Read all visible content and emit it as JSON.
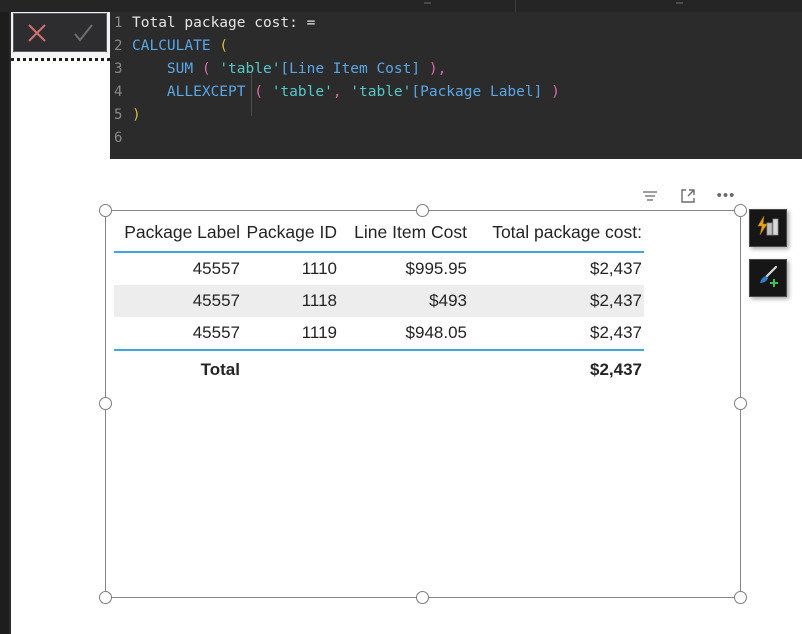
{
  "app": {
    "title": "Power BI Desktop - DAX measure editor with table visual"
  },
  "formula_bar": {
    "cancel_label": "Cancel",
    "accept_label": "Accept",
    "cancel_icon": "close-x-icon",
    "accept_icon": "checkmark-icon",
    "cancel_color": "#d07070",
    "accept_color": "#707070"
  },
  "dax_editor": {
    "background": "#2b2b2b",
    "measure_name": "Total package cost:",
    "line_numbers": [
      "1",
      "2",
      "3",
      "4",
      "5",
      "6"
    ],
    "lines": [
      {
        "number": "1",
        "text": "Total package cost: =",
        "tokens": [
          {
            "t": "Total package cost: =",
            "c": "tok-plain"
          }
        ]
      },
      {
        "number": "2",
        "text": "CALCULATE (",
        "tokens": [
          {
            "t": "CALCULATE ",
            "c": "tok-fn"
          },
          {
            "t": "(",
            "c": "tok-paren1"
          }
        ]
      },
      {
        "number": "3",
        "text": "    SUM ( 'table'[Line Item Cost] ),",
        "tokens": [
          {
            "t": "    ",
            "c": "tok-plain"
          },
          {
            "t": "SUM ",
            "c": "tok-fn"
          },
          {
            "t": "( ",
            "c": "tok-paren2"
          },
          {
            "t": "'table'",
            "c": "tok-str"
          },
          {
            "t": "[Line Item Cost]",
            "c": "tok-brkt"
          },
          {
            "t": " )",
            "c": "tok-paren2"
          },
          {
            "t": ",",
            "c": "tok-comma"
          }
        ]
      },
      {
        "number": "4",
        "text": "    ALLEXCEPT ( 'table', 'table'[Package Label] )",
        "tokens": [
          {
            "t": "    ",
            "c": "tok-plain"
          },
          {
            "t": "ALLEXCEPT ",
            "c": "tok-fn"
          },
          {
            "t": "( ",
            "c": "tok-paren2"
          },
          {
            "t": "'table'",
            "c": "tok-str"
          },
          {
            "t": ",",
            "c": "tok-comma"
          },
          {
            "t": " 'table'",
            "c": "tok-str"
          },
          {
            "t": "[Package Label]",
            "c": "tok-brkt"
          },
          {
            "t": " )",
            "c": "tok-paren2"
          }
        ]
      },
      {
        "number": "5",
        "text": ")",
        "tokens": [
          {
            "t": ")",
            "c": "tok-paren1"
          }
        ]
      },
      {
        "number": "6",
        "text": "",
        "tokens": []
      }
    ]
  },
  "visual_header": {
    "filter_icon": "filter-icon",
    "filter_label": "Filters",
    "focus_icon": "focus-mode-icon",
    "focus_label": "Focus mode",
    "more_icon": "more-options-icon",
    "more_label": "More options",
    "more_glyph": "•••"
  },
  "floating_buttons": [
    {
      "name": "analyze-button",
      "icon": "lightning-bar-chart-icon",
      "label": "Analyze"
    },
    {
      "name": "format-button",
      "icon": "paintbrush-plus-icon",
      "label": "Format"
    }
  ],
  "table_visual": {
    "header_rule_color": "#3da7e0",
    "alt_row_color": "#ededed",
    "columns": [
      "Package Label",
      "Package ID",
      "Line Item Cost",
      "Total package cost:"
    ],
    "rows": [
      [
        "45557",
        "1110",
        "$995.95",
        "$2,437"
      ],
      [
        "45557",
        "1118",
        "$493",
        "$2,437"
      ],
      [
        "45557",
        "1119",
        "$948.05",
        "$2,437"
      ]
    ],
    "total_row": {
      "label": "Total",
      "package_id": "",
      "line_item_cost": "",
      "total_package_cost": "$2,437"
    }
  },
  "chart_data": {
    "type": "table",
    "title": "",
    "columns": [
      "Package Label",
      "Package ID",
      "Line Item Cost",
      "Total package cost:"
    ],
    "rows": [
      {
        "Package Label": "45557",
        "Package ID": "1110",
        "Line Item Cost": "$995.95",
        "Total package cost:": "$2,437"
      },
      {
        "Package Label": "45557",
        "Package ID": "1118",
        "Line Item Cost": "$493",
        "Total package cost:": "$2,437"
      },
      {
        "Package Label": "45557",
        "Package ID": "1119",
        "Line Item Cost": "$948.05",
        "Total package cost:": "$2,437"
      }
    ],
    "totals": {
      "Package Label": "Total",
      "Package ID": "",
      "Line Item Cost": "",
      "Total package cost:": "$2,437"
    }
  }
}
